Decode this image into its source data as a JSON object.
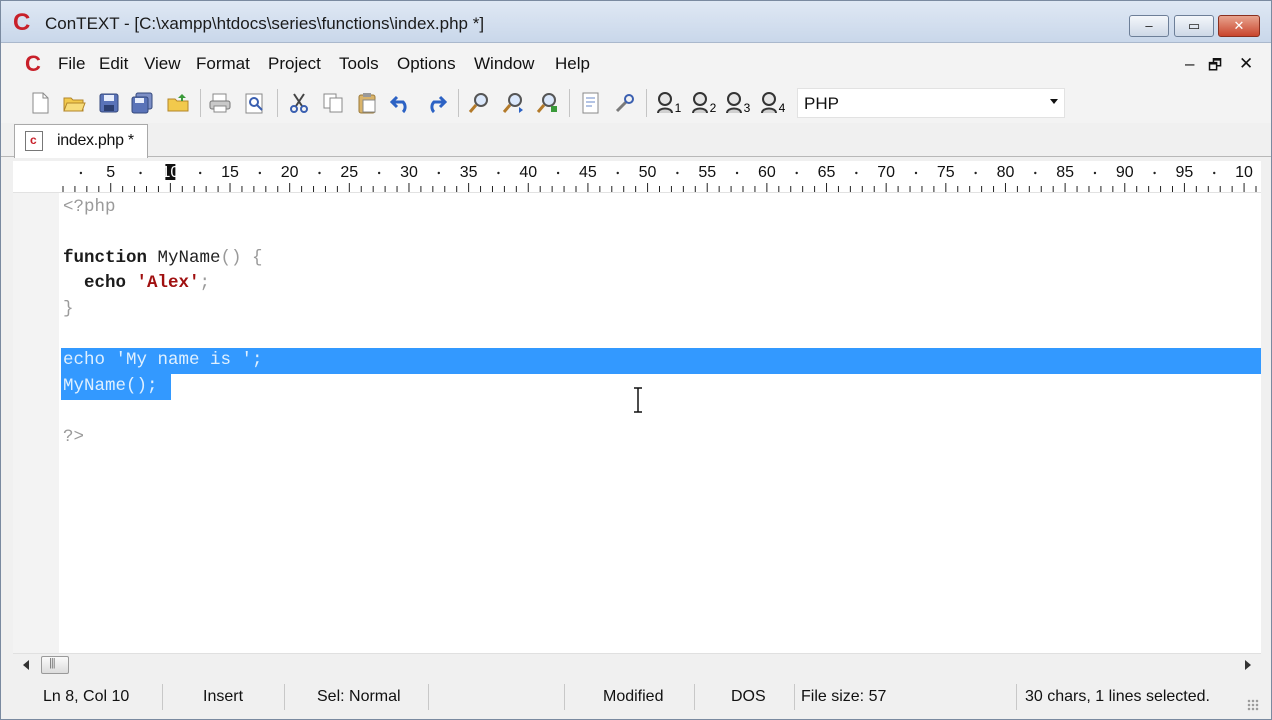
{
  "window": {
    "title": "ConTEXT - [C:\\xampp\\htdocs\\series\\functions\\index.php *]",
    "logo_letter": "C",
    "controls": {
      "minimize": "‒",
      "maximize": "▭",
      "close": "✕"
    }
  },
  "menu": {
    "items": [
      "File",
      "Edit",
      "View",
      "Format",
      "Project",
      "Tools",
      "Options",
      "Window",
      "Help"
    ],
    "mdi": {
      "minimize": "–",
      "restore": "🗗",
      "close": "✕"
    }
  },
  "toolbar": {
    "icons": [
      "new-file-icon",
      "open-folder-icon",
      "save-icon",
      "save-all-icon",
      "open-project-icon",
      "print-icon",
      "print-preview-icon",
      "cut-icon",
      "copy-icon",
      "paste-icon",
      "undo-icon",
      "redo-icon",
      "find-icon",
      "find-next-icon",
      "replace-icon",
      "export-icon",
      "settings-icon",
      "user-1-icon",
      "user-2-icon",
      "user-3-icon",
      "user-4-icon"
    ],
    "user_subscripts": [
      "1",
      "2",
      "3",
      "4"
    ],
    "language": "PHP"
  },
  "tabs": [
    {
      "label": "index.php *",
      "active": true
    }
  ],
  "ruler": {
    "labels": [
      "5",
      "10",
      "15",
      "20",
      "25",
      "30",
      "35",
      "40",
      "45",
      "50",
      "55",
      "60",
      "65",
      "70",
      "75",
      "80",
      "85",
      "90",
      "95",
      "10"
    ]
  },
  "editor": {
    "lines": {
      "l1_open": "<?php",
      "l3_kw": "function",
      "l3_name": " MyName",
      "l3_punc": "() {",
      "l4_indent": "  ",
      "l4_kw": "echo",
      "l4_str": " 'Alex'",
      "l4_punc": ";",
      "l5_punc": "}",
      "l7_sel": "echo 'My name is ';",
      "l8_sel": "MyName();",
      "l10_close": "?>"
    }
  },
  "status": {
    "position": "Ln 8, Col 10",
    "mode": "Insert",
    "selection_mode": "Sel: Normal",
    "modified": "Modified",
    "line_endings": "DOS",
    "file_size": "File size: 57",
    "selection_info": "30 chars, 1 lines selected."
  },
  "colors": {
    "selection": "#3399ff",
    "logo": "#c8202a"
  }
}
